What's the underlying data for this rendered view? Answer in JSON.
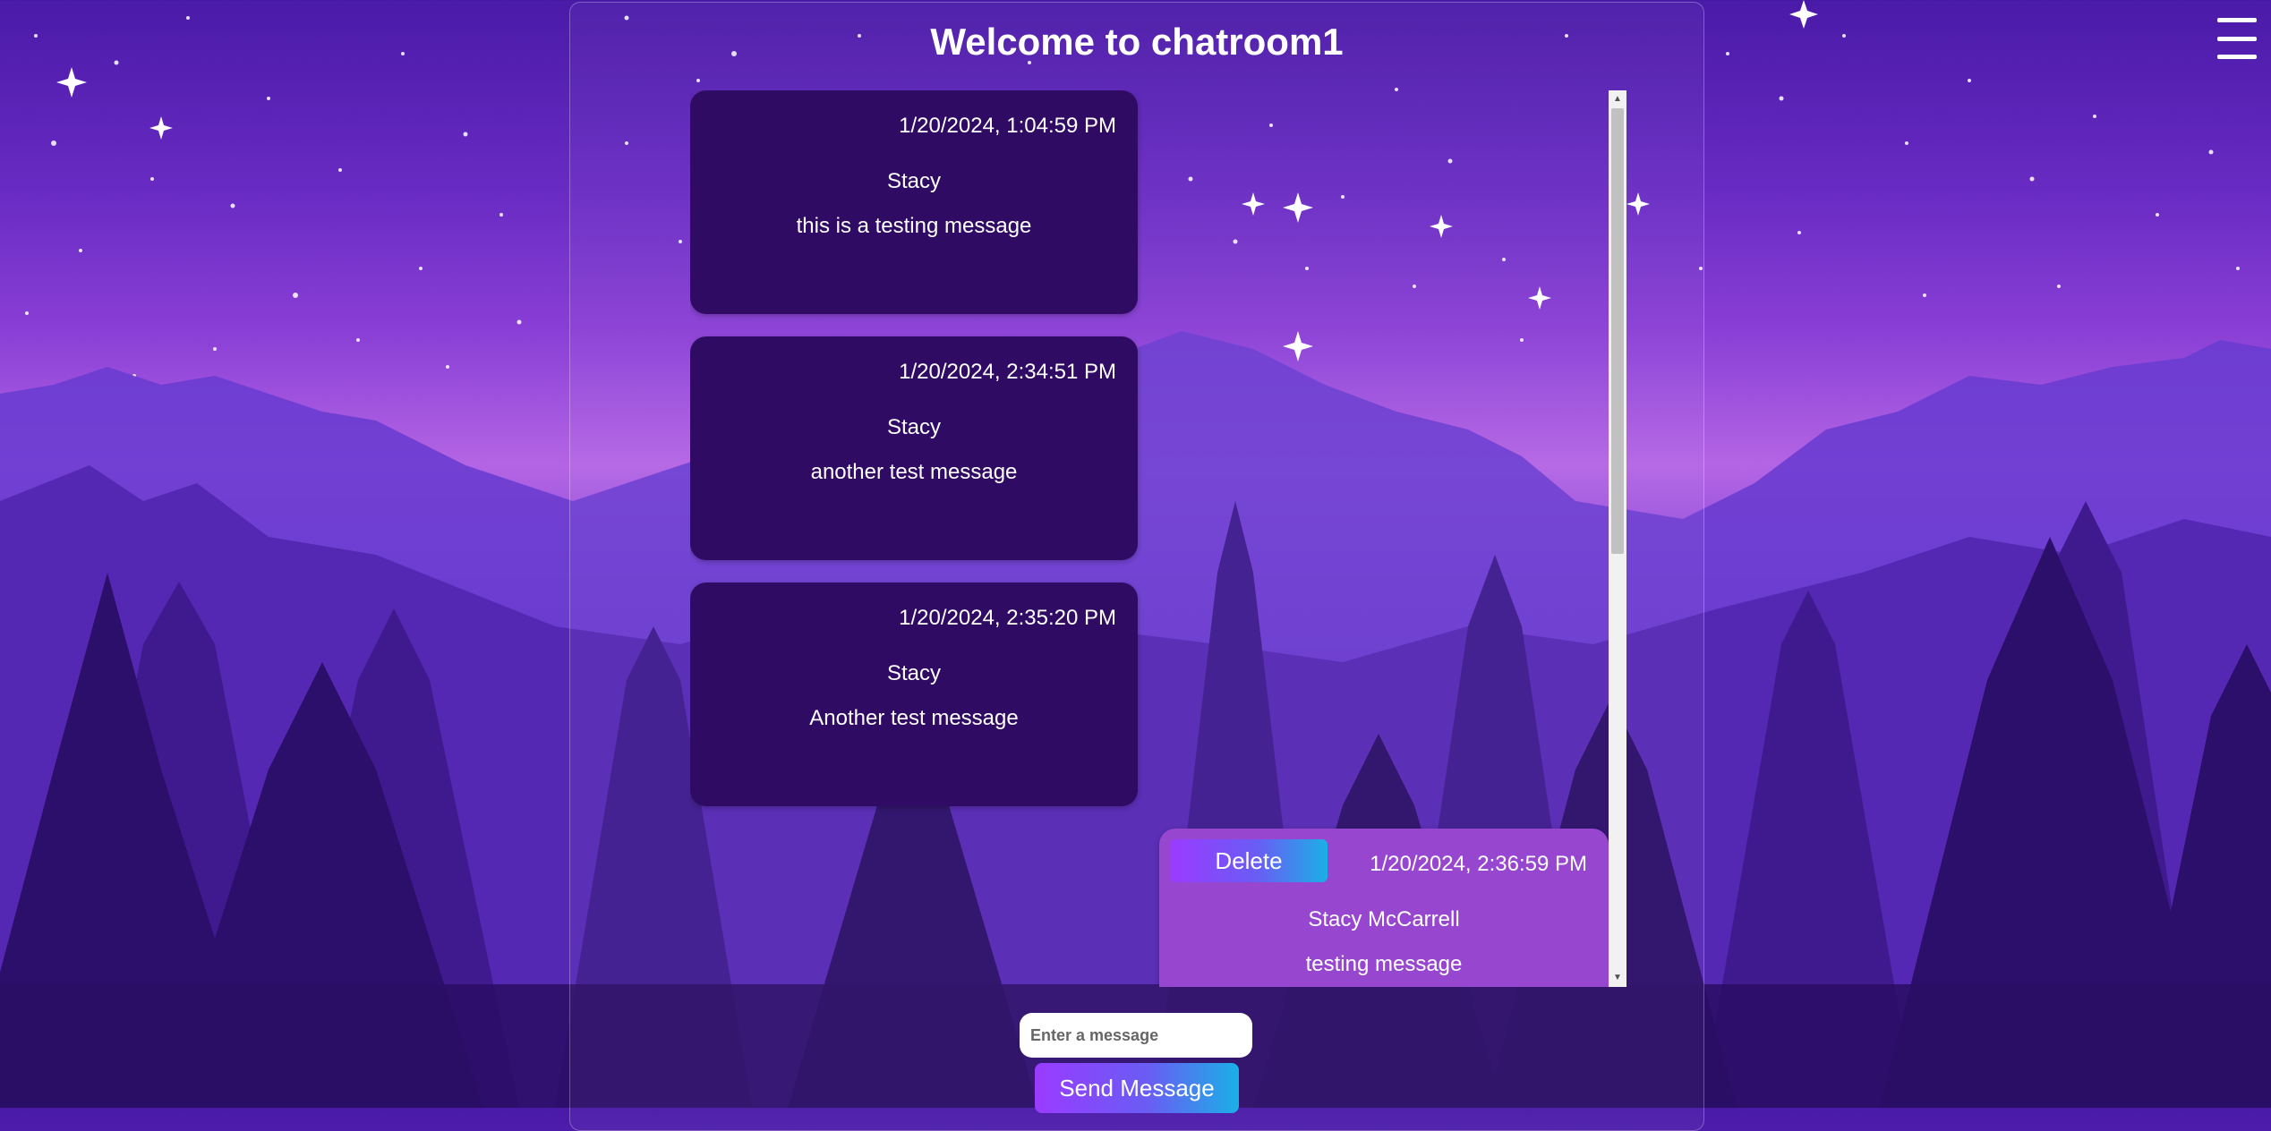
{
  "header": {
    "title": "Welcome to chatroom1"
  },
  "colors": {
    "incoming_bubble": "#300b63",
    "own_bubble": "#9747cf",
    "button_gradient": [
      "#9a3bff",
      "#1ab0e6"
    ]
  },
  "messages": [
    {
      "timestamp": "1/20/2024, 1:04:59 PM",
      "author": "Stacy",
      "text": "this is a testing message"
    },
    {
      "timestamp": "1/20/2024, 2:34:51 PM",
      "author": "Stacy",
      "text": "another test message"
    },
    {
      "timestamp": "1/20/2024, 2:35:20 PM",
      "author": "Stacy",
      "text": "Another test message"
    },
    {
      "timestamp": "1/20/2024, 2:36:59 PM",
      "author": "Stacy McCarrell",
      "text": "testing message",
      "delete_label": "Delete"
    }
  ],
  "composer": {
    "placeholder": "Enter a message",
    "send_label": "Send Message"
  },
  "icons": {
    "menu": "hamburger-menu-icon"
  }
}
